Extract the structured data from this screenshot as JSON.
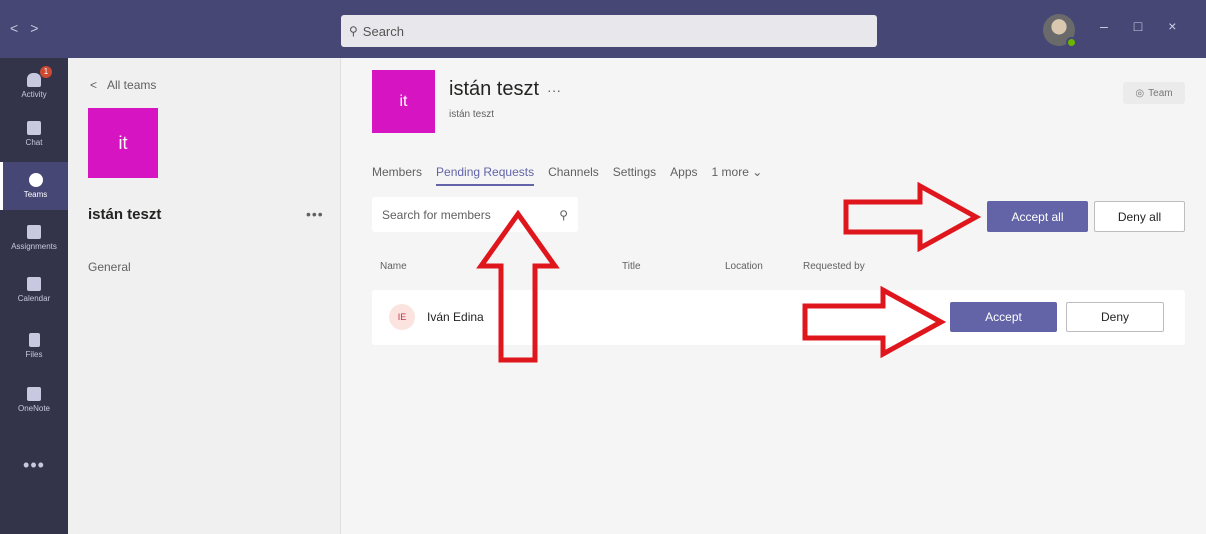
{
  "titlebar": {
    "back": "<",
    "forward": ">",
    "search_placeholder": "Search",
    "minimize": "–",
    "maximize": "□",
    "close": "×"
  },
  "rail": {
    "items": [
      {
        "label": "Activity",
        "icon": "bell-icon",
        "badge": "1"
      },
      {
        "label": "Chat",
        "icon": "chat-icon"
      },
      {
        "label": "Teams",
        "icon": "teams-icon",
        "active": true
      },
      {
        "label": "Assignments",
        "icon": "assignments-icon"
      },
      {
        "label": "Calendar",
        "icon": "calendar-icon"
      },
      {
        "label": "Files",
        "icon": "files-icon"
      },
      {
        "label": "OneNote",
        "icon": "onenote-icon"
      }
    ],
    "more": "•••"
  },
  "leftpanel": {
    "back_label": "All teams",
    "team_initials": "it",
    "team_name": "istán teszt",
    "more": "•••",
    "channel": "General"
  },
  "main": {
    "team_initials": "it",
    "title": "istán teszt",
    "title_more": "···",
    "subtitle": "istán teszt",
    "team_pill": "Team",
    "tabs": [
      {
        "label": "Members"
      },
      {
        "label": "Pending Requests",
        "active": true
      },
      {
        "label": "Channels"
      },
      {
        "label": "Settings"
      },
      {
        "label": "Apps"
      },
      {
        "label": "1 more"
      }
    ],
    "search_placeholder": "Search for members",
    "accept_all": "Accept all",
    "deny_all": "Deny all",
    "columns": [
      "Name",
      "Title",
      "Location",
      "Requested by"
    ],
    "requests": [
      {
        "initials": "IE",
        "name": "Iván Edina",
        "accept": "Accept",
        "deny": "Deny"
      }
    ]
  },
  "colors": {
    "titlebar": "#464775",
    "rail": "#33344a",
    "accent": "#6264a7",
    "team_tile": "#d614c1",
    "annotation": "#e0161d"
  }
}
